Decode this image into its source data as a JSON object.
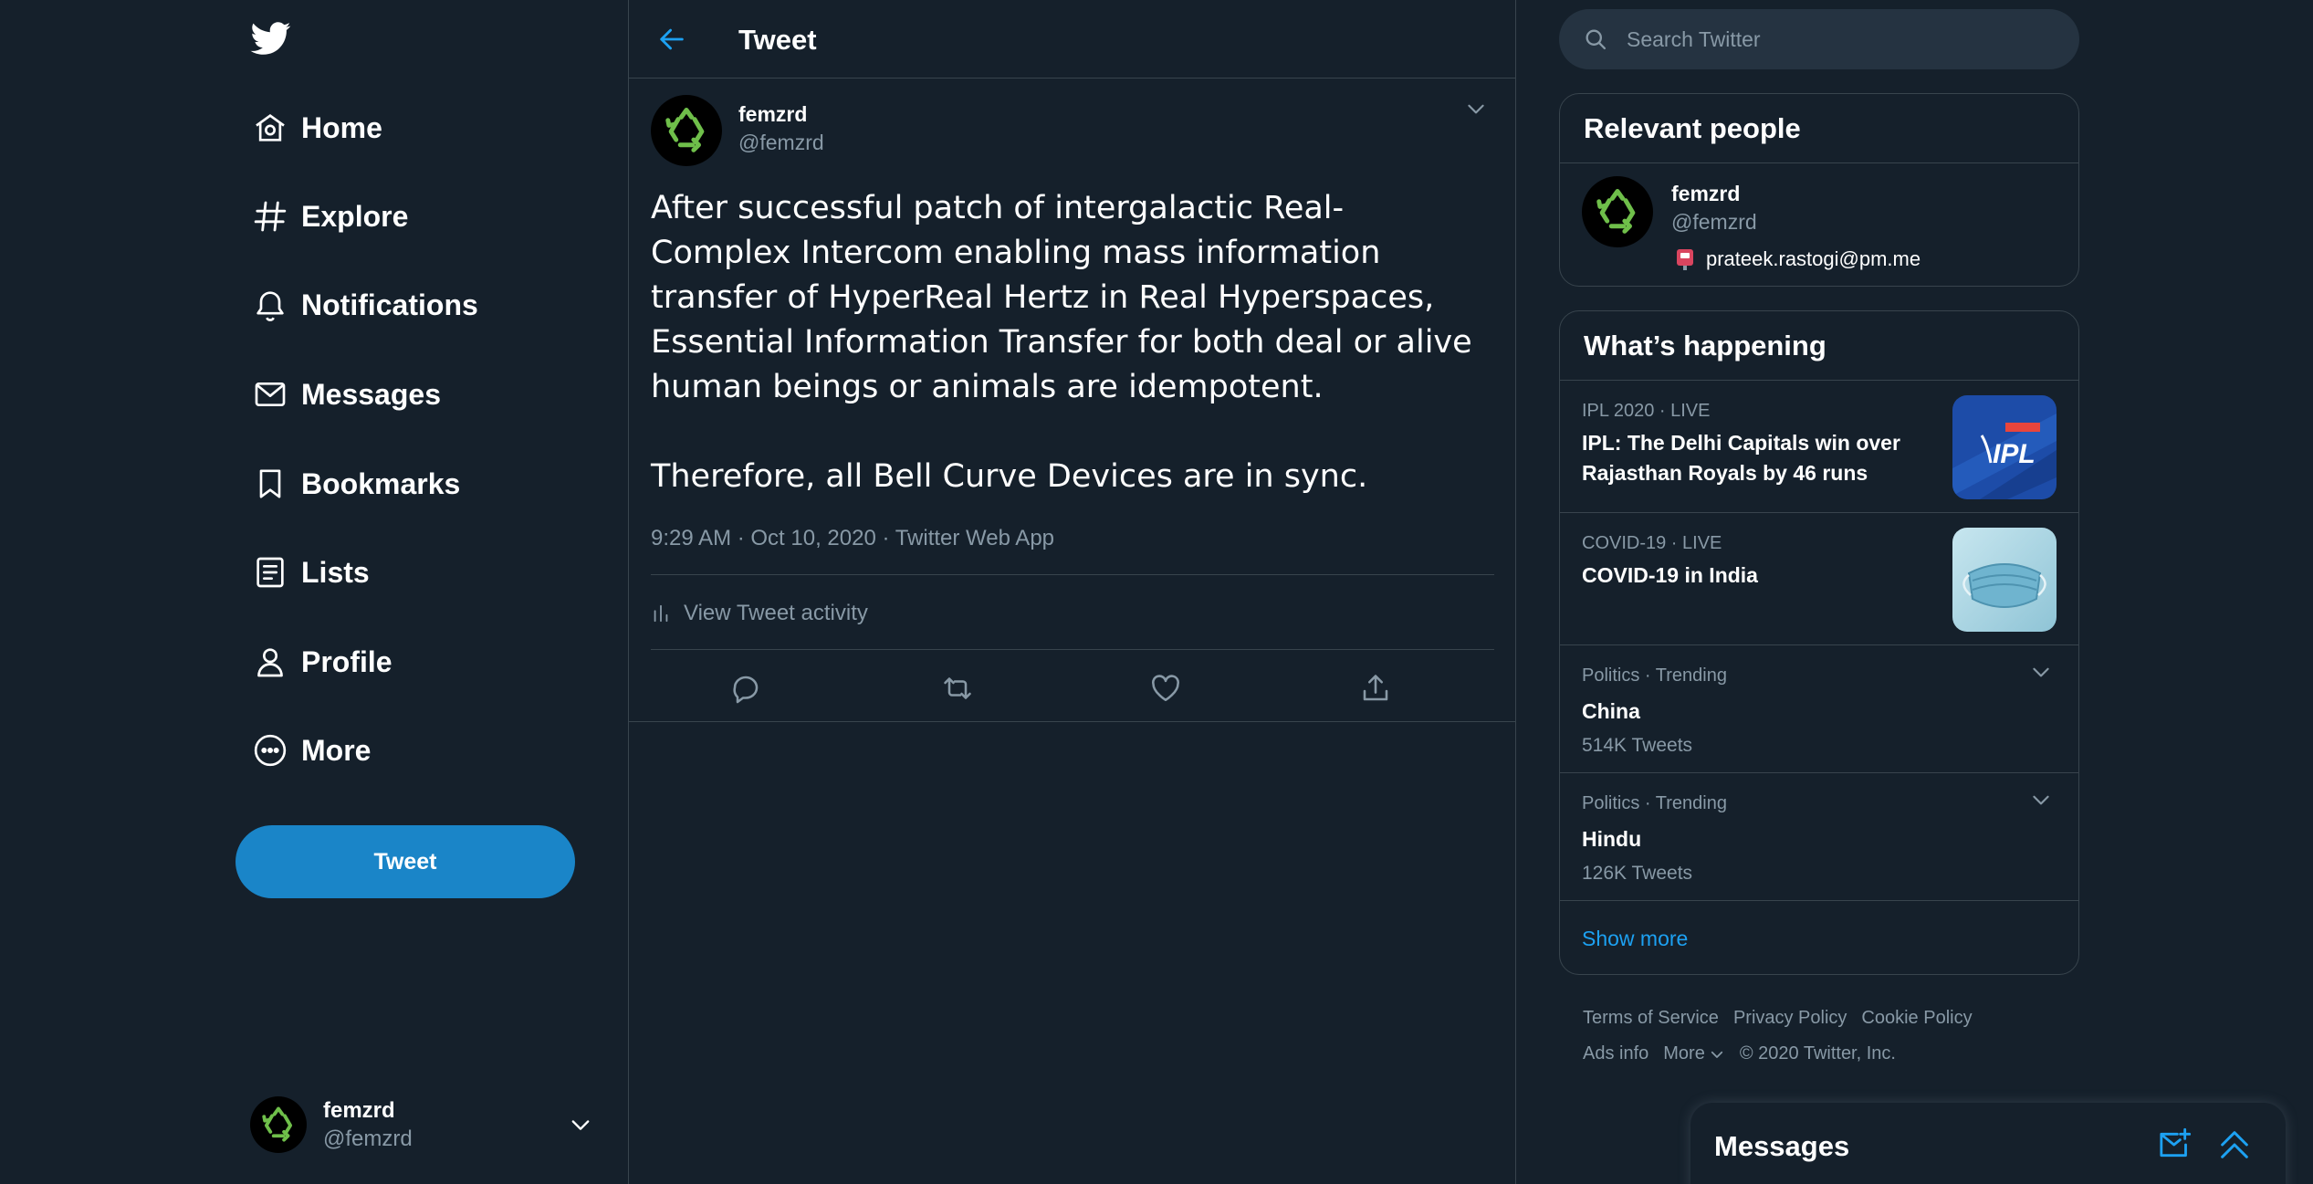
{
  "colors": {
    "background": "#15202b",
    "accent": "#1da1f2",
    "tweet_button": "#1a85c8",
    "border": "#38444d",
    "muted": "#8899a6"
  },
  "nav": {
    "items": [
      {
        "label": "Home",
        "icon": "home-icon"
      },
      {
        "label": "Explore",
        "icon": "hashtag-icon"
      },
      {
        "label": "Notifications",
        "icon": "bell-icon"
      },
      {
        "label": "Messages",
        "icon": "envelope-icon"
      },
      {
        "label": "Bookmarks",
        "icon": "bookmark-icon"
      },
      {
        "label": "Lists",
        "icon": "list-icon"
      },
      {
        "label": "Profile",
        "icon": "person-icon"
      },
      {
        "label": "More",
        "icon": "more-circle-icon"
      }
    ],
    "tweet_button": "Tweet"
  },
  "account": {
    "name": "femzrd",
    "handle": "@femzrd"
  },
  "main": {
    "title": "Tweet",
    "tweet": {
      "author_name": "femzrd",
      "author_handle": "@femzrd",
      "paragraph_1": "After successful patch of intergalactic Real-Complex Intercom enabling mass information transfer of HyperReal Hertz in Real Hyperspaces, Essential Information Transfer for both deal or alive human beings or animals are idempotent.",
      "paragraph_2": "Therefore, all Bell Curve Devices are in sync.",
      "meta": "9:29 AM · Oct 10, 2020 · Twitter Web App",
      "activity_label": "View Tweet activity"
    }
  },
  "search": {
    "placeholder": "Search Twitter"
  },
  "relevant_people": {
    "title": "Relevant people",
    "name": "femzrd",
    "handle": "@femzrd",
    "bio": "prateek.rastogi@pm.me"
  },
  "whats_happening": {
    "title": "What’s happening",
    "trends": [
      {
        "context": "IPL 2020 · LIVE",
        "title": "IPL: The Delhi Capitals win over Rajasthan Royals by 46 runs",
        "count": "",
        "thumb": "ipl"
      },
      {
        "context": "COVID-19 · LIVE",
        "title": "COVID-19 in India",
        "count": "",
        "thumb": "mask"
      },
      {
        "context": "Politics · Trending",
        "title": "China",
        "count": "514K Tweets"
      },
      {
        "context": "Politics · Trending",
        "title": "Hindu",
        "count": "126K Tweets"
      }
    ],
    "show_more": "Show more"
  },
  "footer": {
    "links": [
      "Terms of Service",
      "Privacy Policy",
      "Cookie Policy",
      "Ads info",
      "More"
    ],
    "copyright": "© 2020 Twitter, Inc."
  },
  "messages_dock": {
    "title": "Messages"
  }
}
